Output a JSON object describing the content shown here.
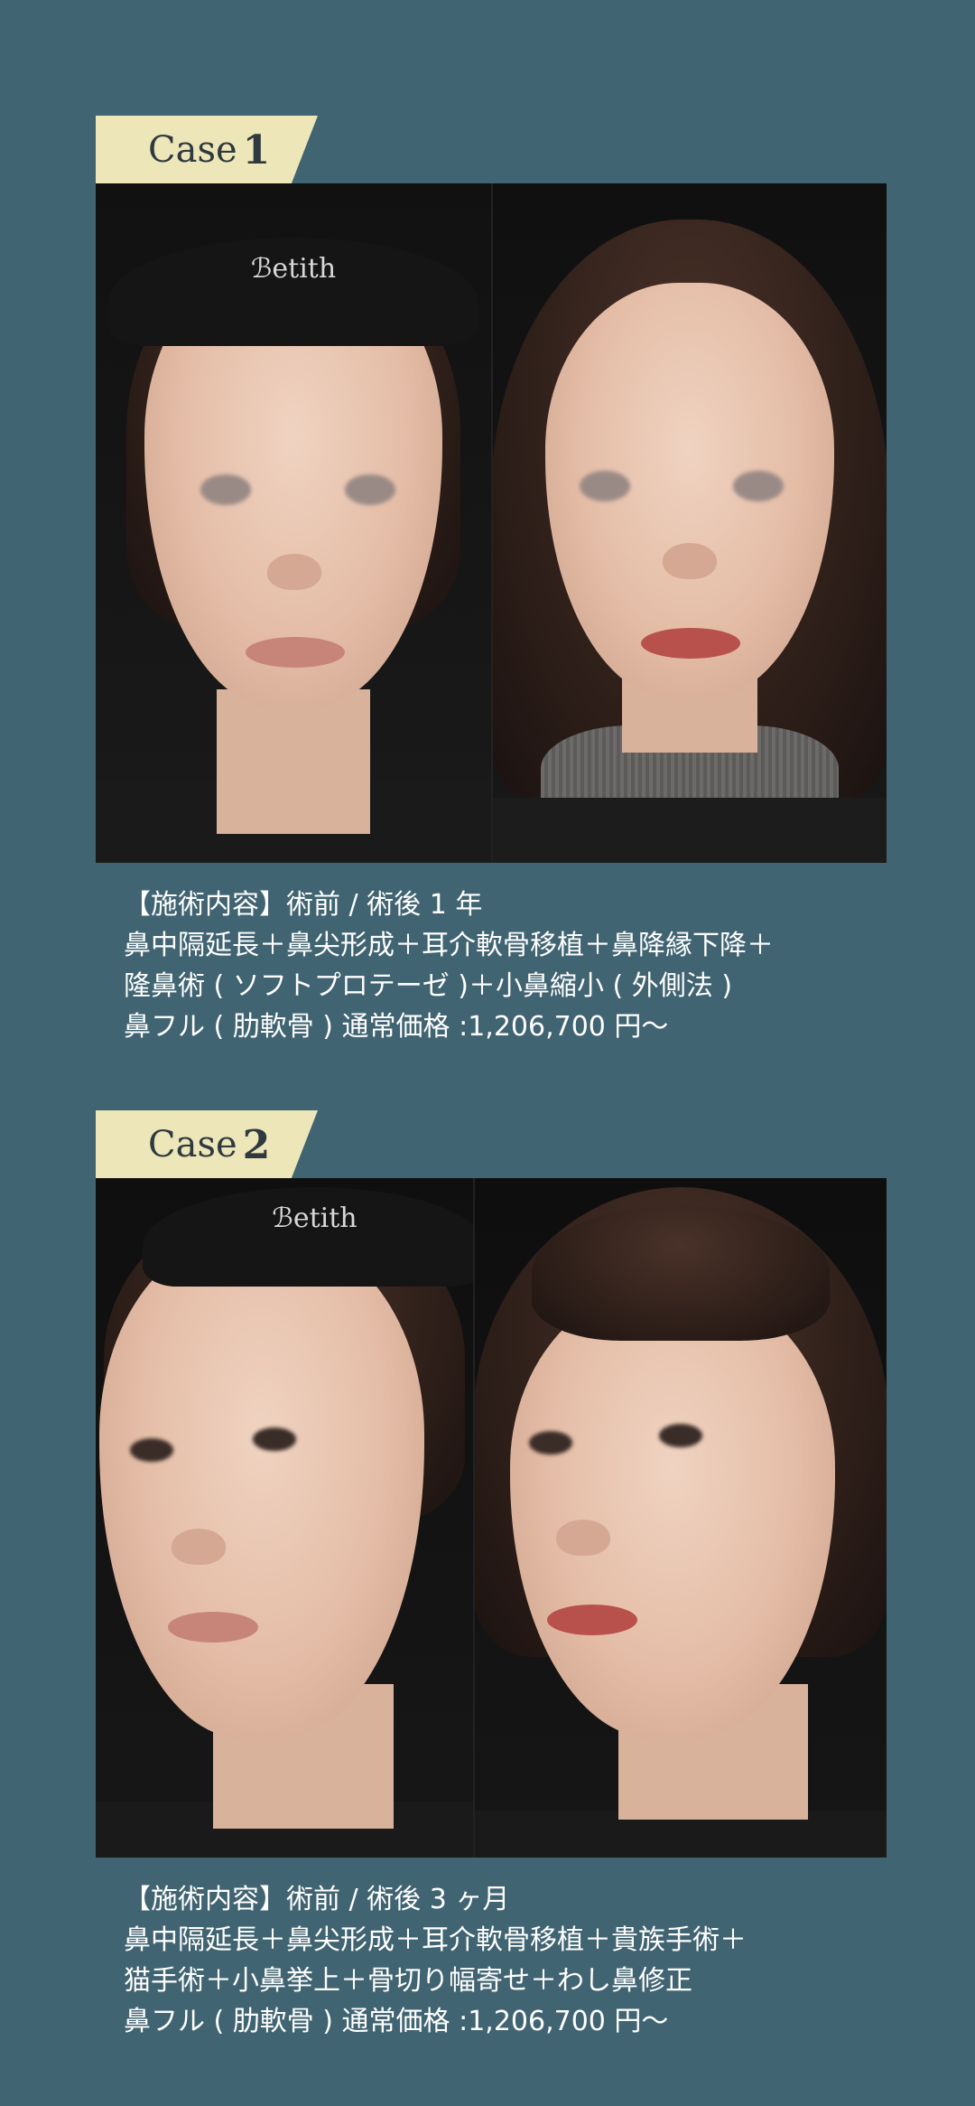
{
  "cases": [
    {
      "label_word": "Case",
      "label_number": "1",
      "photo_alt": "Before / after front view",
      "caption": {
        "line1": "【施術内容】術前 / 術後 1 年",
        "line2": "鼻中隔延長＋鼻尖形成＋耳介軟骨移植＋鼻降縁下降＋",
        "line3": "隆鼻術 ( ソフトプロテーゼ )＋小鼻縮小 ( 外側法 )",
        "line4": "鼻フル ( 肋軟骨 ) 通常価格 :1,206,700 円〜"
      }
    },
    {
      "label_word": "Case",
      "label_number": "2",
      "photo_alt": "Before / after oblique view",
      "caption": {
        "line1": "【施術内容】術前 / 術後 3 ヶ月",
        "line2": "鼻中隔延長＋鼻尖形成＋耳介軟骨移植＋貴族手術＋",
        "line3": "猫手術＋小鼻挙上＋骨切り幅寄せ＋わし鼻修正",
        "line4": "鼻フル ( 肋軟骨 ) 通常価格 :1,206,700 円〜"
      }
    }
  ],
  "headband_text": "ℬetith",
  "colors": {
    "background": "#416472",
    "label_bg": "#ede6b8",
    "label_text": "#2f3a40",
    "photo_bg": "#0e0e0e",
    "caption_text": "#ffffff"
  }
}
